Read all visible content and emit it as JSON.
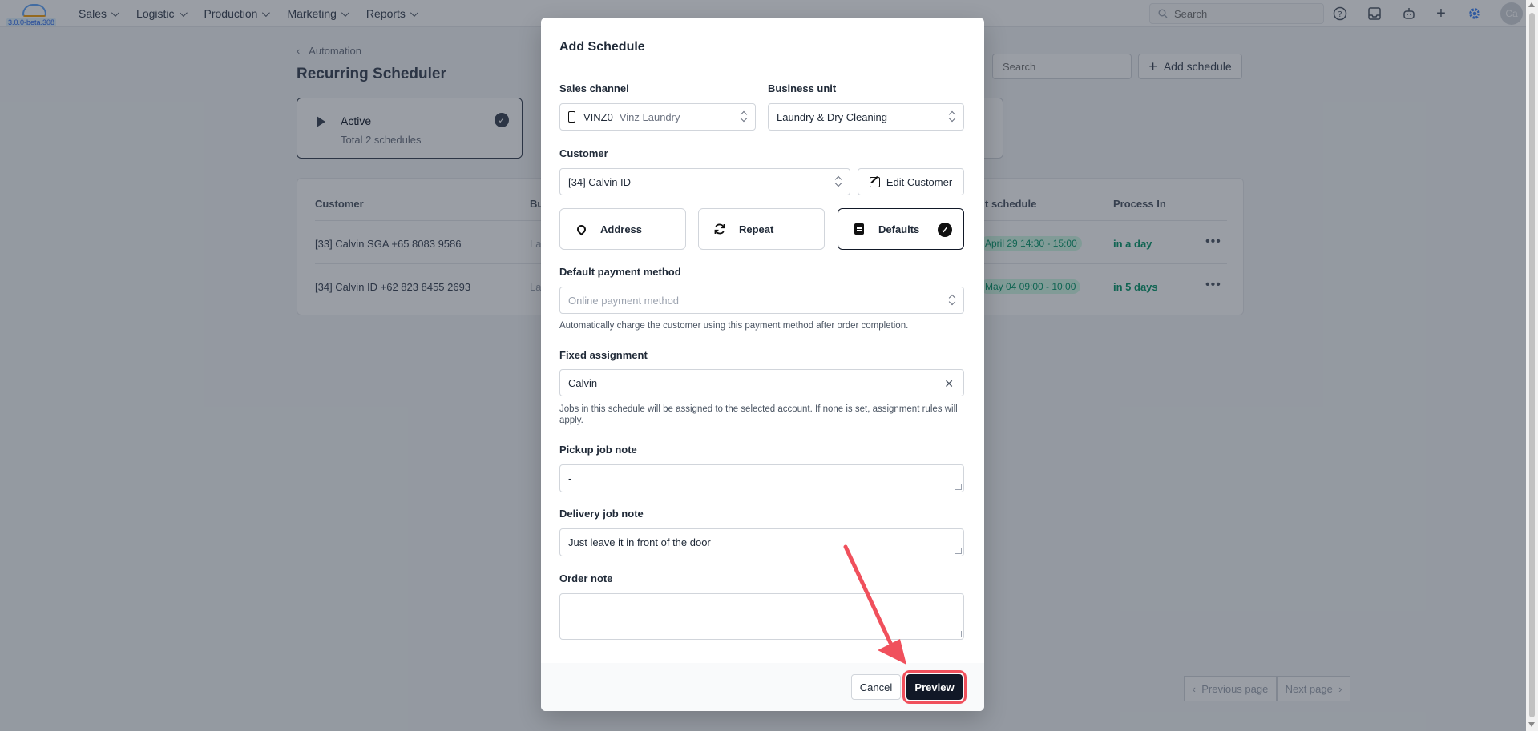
{
  "app": {
    "version": "3.0.0-beta.308",
    "nav": [
      "Sales",
      "Logistic",
      "Production",
      "Marketing",
      "Reports"
    ],
    "search_placeholder": "Search",
    "avatar_initials": "Ca"
  },
  "page": {
    "breadcrumb": "Automation",
    "title": "Recurring Scheduler",
    "search_placeholder": "Search",
    "add_button": "Add schedule",
    "status_card": {
      "title": "Active",
      "subtitle": "Total 2 schedules"
    },
    "table": {
      "headers": {
        "customer": "Customer",
        "business_unit": "Bu",
        "next_schedule": "t schedule",
        "process_in": "Process In"
      },
      "rows": [
        {
          "customer": "[33] Calvin SGA +65 8083 9586",
          "business_unit": "La",
          "schedule": "April 29 14:30 - 15:00",
          "process_in": "in a day"
        },
        {
          "customer": "[34] Calvin ID +62 823 8455 2693",
          "business_unit": "La",
          "schedule": "May 04 09:00 - 10:00",
          "process_in": "in 5 days"
        }
      ]
    },
    "pager": {
      "previous": "Previous page",
      "next": "Next page"
    }
  },
  "modal": {
    "title": "Add Schedule",
    "sales_channel": {
      "label": "Sales channel",
      "code": "VINZ0",
      "name": "Vinz Laundry"
    },
    "business_unit": {
      "label": "Business unit",
      "value": "Laundry & Dry Cleaning"
    },
    "customer": {
      "label": "Customer",
      "value": "[34] Calvin ID",
      "edit_button": "Edit Customer"
    },
    "tabs": {
      "address": "Address",
      "repeat": "Repeat",
      "defaults": "Defaults"
    },
    "payment": {
      "label": "Default payment method",
      "placeholder": "Online payment method",
      "help": "Automatically charge the customer using this payment method after order completion."
    },
    "assignment": {
      "label": "Fixed assignment",
      "value": "Calvin",
      "help": "Jobs in this schedule will be assigned to the selected account. If none is set, assignment rules will apply."
    },
    "pickup_note": {
      "label": "Pickup job note",
      "value": "-"
    },
    "delivery_note": {
      "label": "Delivery job note",
      "value": "Just leave it in front of the door"
    },
    "order_note": {
      "label": "Order note",
      "value": ""
    },
    "cancel_button": "Cancel",
    "preview_button": "Preview"
  },
  "colors": {
    "annotation": "#f0505c",
    "primary": "#111827",
    "success": "#059669"
  }
}
